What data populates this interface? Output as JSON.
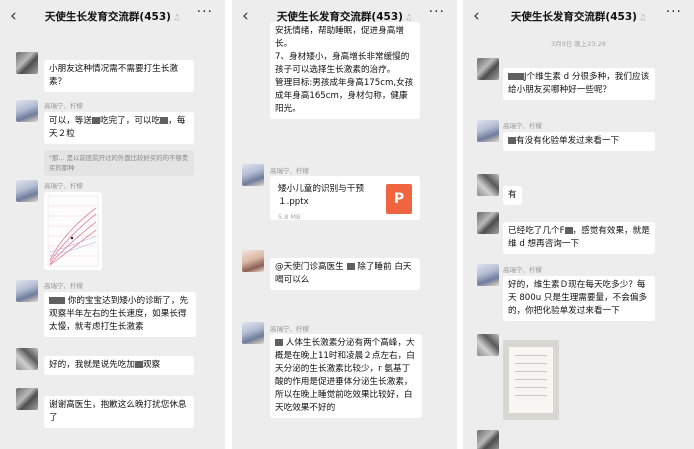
{
  "chat_title": "天使生长发育交流群(453)",
  "icons": {
    "back": "‹",
    "more": "···",
    "mute": "♫"
  },
  "panel1": {
    "m1": "小朋友这种情况需不需要打生长激素？",
    "m2_name": "高瑞宁、柠檬",
    "m2_line1a": "可以，等送",
    "m2_line1b": "吃完了，可以吃",
    "m2_line2": "，每天２粒",
    "m2_quote": "\"那… 是以前医院开过的外面比较好买的的不够贵买的那种",
    "m3_name": "高瑞宁、柠檬",
    "m4_name": "高瑞宁、柠檬",
    "m4_text_a": "你的宝宝达到矮小的诊断了，先观察半年左右的生长速度，如果长得太慢，就考虑打生长激素",
    "m5a": "好的，我就是说先吃加",
    "m5b": "观察",
    "m6": "谢谢高医生，抱歉这么晚打扰您休息了"
  },
  "panel2": {
    "m1": "安抚情绪，帮助睡眠，促进身高增长。\n7、身材矮小，身高增长非常缓慢的孩子可以选择生长激素的治疗。\n管理目标:男孩成年身高175cm,女孩成年身高165cm，身材匀称，健康阳光。",
    "m2_name": "高瑞宁、柠檬",
    "file_name": "矮小儿童的识别与干预１.pptx",
    "file_size": "5.8 MB",
    "file_icon": "P",
    "m3a": "@天使门诊高医生",
    "m3b": "除了睡前 白天喝可以么",
    "m4_name": "高瑞宁、柠檬",
    "m4": "人体生长激素分泌有两个高峰，大概是在晚上11时和凌晨２点左右，白天分泌的生长激素比较少，r 氨基丁酸的作用是促进垂体分泌生长激素，所以在晚上睡觉前吃效果比较好，白天吃效果不好的"
  },
  "panel3": {
    "timestamp": "3月9日 晚上23:28",
    "m1a": "J个维生素 d 分很多种，我们应该给小朋友买哪种好一些呢？",
    "m2_name": "高瑞宁、柠檬",
    "m2": "有没有化验单发过来看一下",
    "m3": "有",
    "m4": "已经吃了几个F",
    "m4b": "，感觉有效果，就是维 d 想再咨询一下",
    "m5_name": "高瑞宁、柠檬",
    "m5": "好的，维生素Ｄ现在每天吃多少？每天 800u 只是生理需要量，不会偏多的，你把化验单发过来看一下"
  }
}
